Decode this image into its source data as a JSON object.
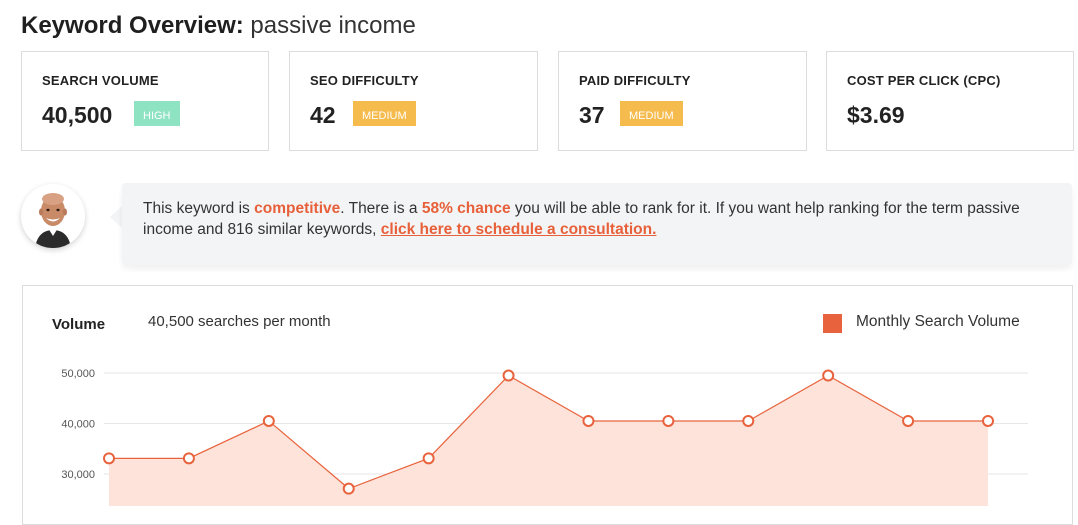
{
  "header": {
    "title_bold": "Keyword Overview:",
    "title_keyword": "passive income"
  },
  "cards": [
    {
      "label": "SEARCH VOLUME",
      "value": "40,500",
      "badge": "HIGH",
      "badge_color": "#8ee3c3"
    },
    {
      "label": "SEO DIFFICULTY",
      "value": "42",
      "badge": "MEDIUM",
      "badge_color": "#f5bb4d"
    },
    {
      "label": "PAID DIFFICULTY",
      "value": "37",
      "badge": "MEDIUM",
      "badge_color": "#f5bb4d"
    },
    {
      "label": "COST PER CLICK (CPC)",
      "value": "$3.69"
    }
  ],
  "message": {
    "part1": "This keyword is ",
    "competitive": "competitive",
    "part2": ". There is a ",
    "chance": "58% chance",
    "part3": " you will be able to rank for it. If you want help ranking for the term passive income and 816 similar keywords, ",
    "link": "click here to schedule a consultation."
  },
  "volume": {
    "label": "Volume",
    "sub": "40,500 searches per month",
    "legend": "Monthly Search Volume",
    "legend_color": "#e8633d"
  },
  "chart_data": {
    "type": "area",
    "series": [
      {
        "name": "Monthly Search Volume",
        "values": [
          33100,
          33100,
          40500,
          27100,
          33100,
          49500,
          40500,
          40500,
          40500,
          49500,
          40500,
          40500
        ]
      }
    ],
    "yticks": [
      "50,000",
      "40,000",
      "30,000"
    ],
    "ytick_values": [
      50000,
      40000,
      30000
    ],
    "line_color": "#e8633d",
    "fill_color": "#fde3da",
    "grid": true
  }
}
